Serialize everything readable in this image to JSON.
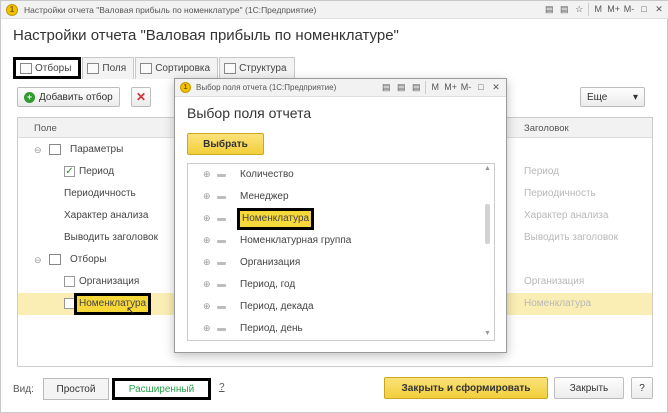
{
  "window": {
    "title": "Настройки отчета \"Валовая прибыль по номенклатуре\"  (1С:Предприятие)",
    "tb_icons": [
      "▤",
      "▤",
      "☆",
      "M",
      "M+",
      "M-",
      "□",
      "✕"
    ]
  },
  "page_title": "Настройки отчета \"Валовая прибыль по номенклатуре\"",
  "tabs": [
    {
      "label": "Отборы",
      "active": true
    },
    {
      "label": "Поля",
      "active": false
    },
    {
      "label": "Сортировка",
      "active": false
    },
    {
      "label": "Структура",
      "active": false
    }
  ],
  "toolbar": {
    "add_label": "Добавить отбор",
    "more_label": "Еще",
    "more_arrow": "▾"
  },
  "grid": {
    "col_field": "Поле",
    "col_header": "Заголовок",
    "rows": [
      {
        "label": "Параметры",
        "header": ""
      },
      {
        "label": "Период",
        "header": "Период",
        "checked": true
      },
      {
        "label": "Периодичность",
        "header": "Периодичность"
      },
      {
        "label": "Характер анализа",
        "header": "Характер анализа"
      },
      {
        "label": "Выводить заголовок",
        "header": "Выводить заголовок"
      },
      {
        "label": "Отборы",
        "header": ""
      },
      {
        "label": "Организация",
        "header": "Организация",
        "checked": false
      },
      {
        "label": "Номенклатура",
        "header": "Номенклатура",
        "checked": false
      }
    ]
  },
  "footer": {
    "view_label": "Вид:",
    "simple_label": "Простой",
    "extended_label": "Расширенный",
    "help_q": "?",
    "main_btn": "Закрыть и сформировать",
    "close_btn": "Закрыть",
    "help_btn": "?"
  },
  "modal": {
    "window_title": "Выбор поля отчета  (1С:Предприятие)",
    "tb_icons": [
      "▤",
      "▤",
      "▤",
      "M",
      "M+",
      "M-",
      "□",
      "✕"
    ],
    "title": "Выбор поля отчета",
    "select_btn": "Выбрать",
    "items": [
      "Количество",
      "Менеджер",
      "Номенклатура",
      "Номенклатурная группа",
      "Организация",
      "Период, год",
      "Период, декада",
      "Период, день"
    ],
    "selected_index": 2
  },
  "colors": {
    "accent_yellow": "#f2cf3a",
    "selection": "#fbeeb4",
    "green_text": "#26a04a"
  }
}
